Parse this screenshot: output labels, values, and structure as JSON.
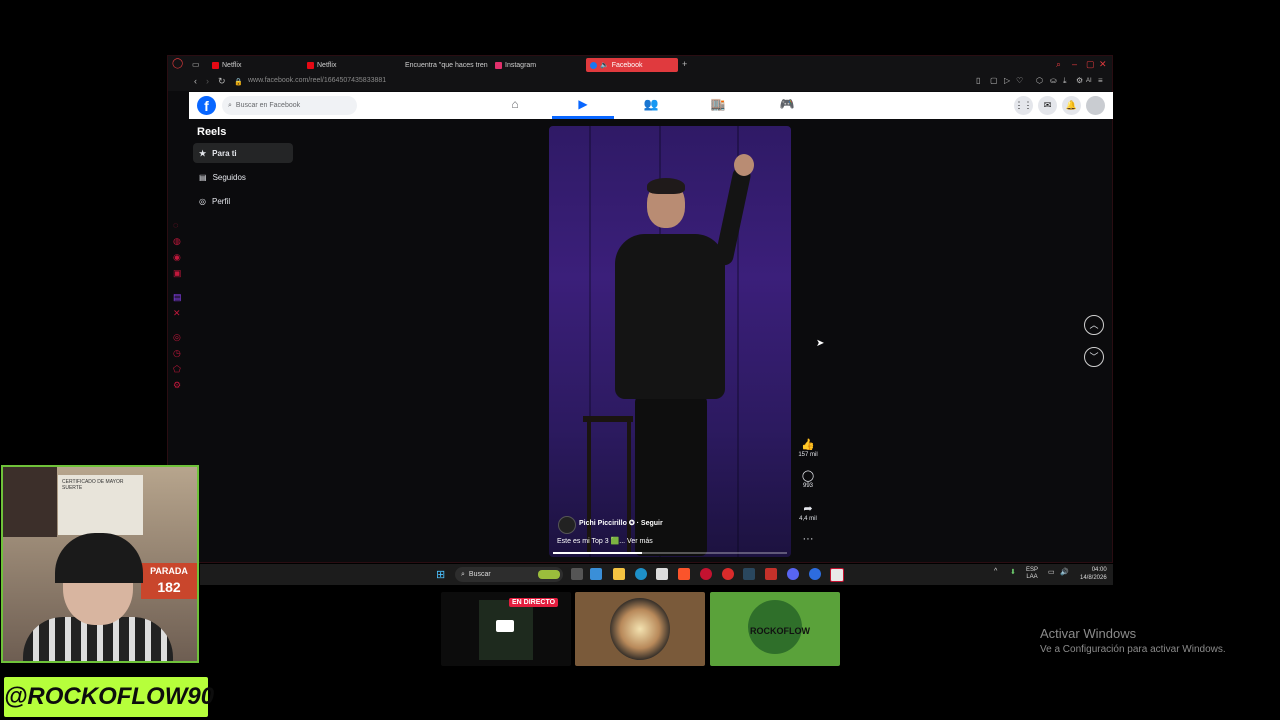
{
  "browser": {
    "tabs": [
      {
        "label": "Netflix",
        "color": "#e50914"
      },
      {
        "label": "Netflix",
        "color": "#e50914"
      },
      {
        "label": "Encuentra \"que haces tren",
        "color": "#ffffff"
      },
      {
        "label": "Instagram",
        "color": "#e1306c"
      },
      {
        "label": "Facebook",
        "color": "#1877f2",
        "active": true
      }
    ],
    "url": "www.facebook.com/reel/1664507435833881",
    "ai_label": "AI"
  },
  "facebook": {
    "search_placeholder": "Buscar en Facebook",
    "brand_color": "#0866ff"
  },
  "reels": {
    "title": "Reels",
    "menu": [
      {
        "label": "Para ti",
        "icon": "star-icon",
        "active": true
      },
      {
        "label": "Seguidos",
        "icon": "following-icon"
      },
      {
        "label": "Perfil",
        "icon": "profile-icon"
      }
    ],
    "video": {
      "author": "Pichi Piccirillo",
      "follow": "Seguir",
      "caption": "Este es mi Top 3 🟩... Ver más",
      "progress_fraction": 0.38
    },
    "actions": {
      "likes": "157 mil",
      "comments": "993",
      "shares": "4,4 mil"
    }
  },
  "taskbar": {
    "search_label": "Buscar",
    "lang_top": "ESP",
    "lang_bottom": "LAA",
    "time": "04:00",
    "date": "14/8/2026"
  },
  "thumbnails": {
    "live_label": "EN DIRECTO",
    "channel_small": "ROCKOFLOW"
  },
  "webcam": {
    "cert_text": "CERTIFICADO DE MAYOR SUERTE",
    "sign_top": "PARADA",
    "sign_number": "182",
    "channel_tag": "@ROCKOFLOW90"
  },
  "activation": {
    "title": "Activar Windows",
    "subtitle": "Ve a Configuración para activar Windows."
  }
}
